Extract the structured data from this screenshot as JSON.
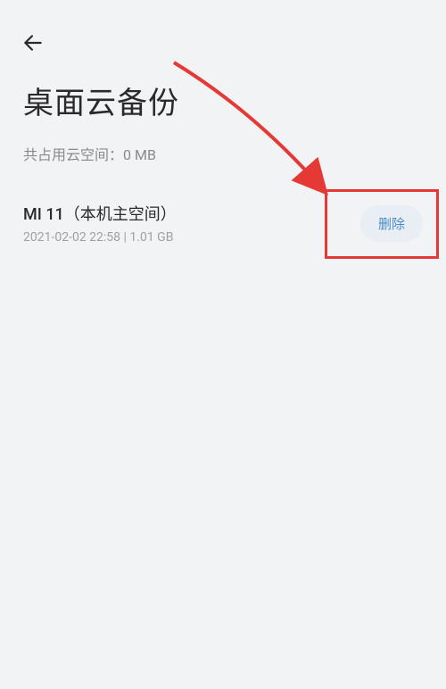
{
  "header": {
    "title": "桌面云备份"
  },
  "storage": {
    "label_prefix": "共占用云空间：",
    "value": "0 MB"
  },
  "backup": {
    "device_name": "MI 11（本机主空间）",
    "timestamp": "2021-02-02 22:58",
    "size": "1.01 GB",
    "delete_label": "删除"
  }
}
